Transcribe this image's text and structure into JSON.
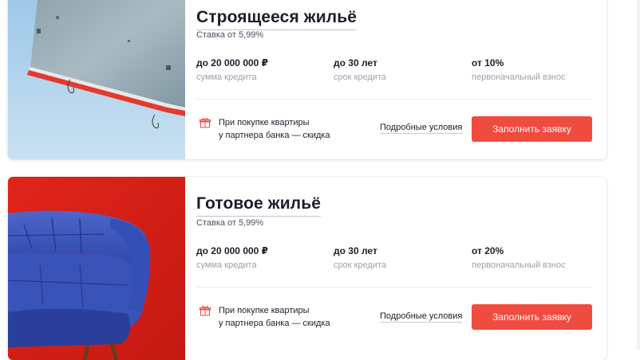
{
  "cards": [
    {
      "title": "Строящееся жильё",
      "rate": "Ставка от 5,99%",
      "params": [
        {
          "value": "до 20 000 000 ₽",
          "label": "сумма кредита"
        },
        {
          "value": "до 30 лет",
          "label": "срок кредита"
        },
        {
          "value": "от 10%",
          "label": "первоначальный взнос"
        }
      ],
      "promo_line1": "При покупке квартиры",
      "promo_line2": "у партнера банка — скидка",
      "details_label": "Подробные условия",
      "apply_label": "Заполнить заявку"
    },
    {
      "title": "Готовое жильё",
      "rate": "Ставка от 5,99%",
      "params": [
        {
          "value": "до 20 000 000 ₽",
          "label": "сумма кредита"
        },
        {
          "value": "до 30 лет",
          "label": "срок кредита"
        },
        {
          "value": "от 20%",
          "label": "первоначальный взнос"
        }
      ],
      "promo_line1": "При покупке квартиры",
      "promo_line2": "у партнера банка — скидка",
      "details_label": "Подробные условия",
      "apply_label": "Заполнить заявку"
    }
  ],
  "colors": {
    "accent": "#ef4b3f",
    "text": "#1b1f2b",
    "muted": "#9aa1ad"
  },
  "icons": {
    "promo": "gift-icon"
  }
}
